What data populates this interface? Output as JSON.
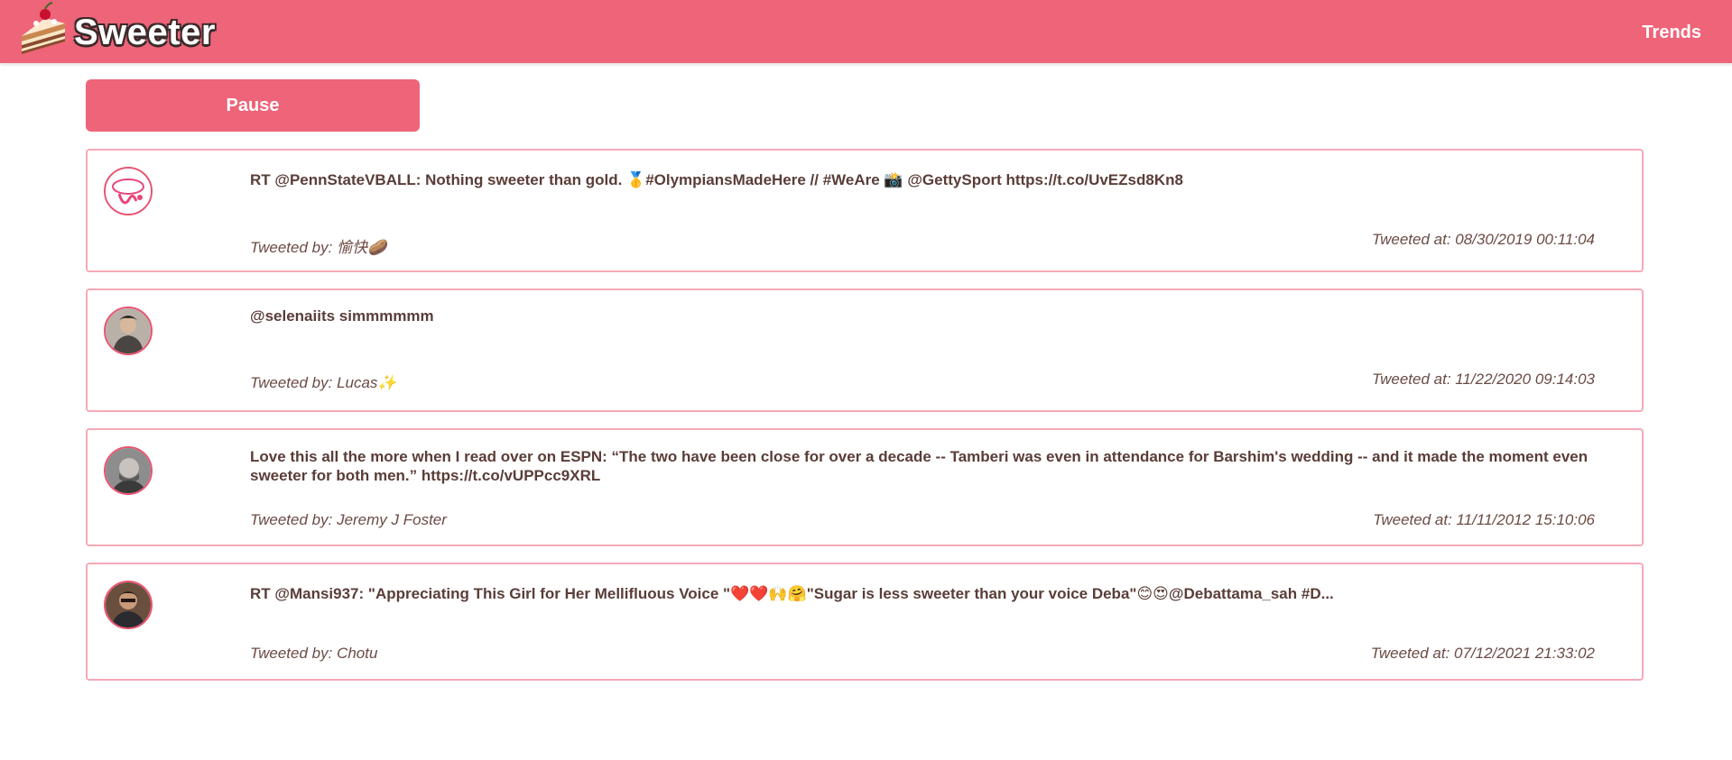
{
  "header": {
    "brand": "Sweeter",
    "nav": {
      "trends_label": "Trends"
    },
    "logo_icon": "cake-slice-icon",
    "colors": {
      "bar": "#ee6479",
      "card_border": "#f7a9b6",
      "text": "#5a3d37"
    }
  },
  "controls": {
    "pause_label": "Pause"
  },
  "tweets": [
    {
      "text": "RT @PennStateVBALL: Nothing sweeter than gold. 🥇#OlympiansMadeHere // #WeAre 📸 @GettySport https://t.co/UvEZsd8Kn8",
      "by": "Tweeted by: 愉快🥔",
      "at": "Tweeted at: 08/30/2019 00:11:04",
      "avatar": "pink-logo-avatar"
    },
    {
      "text": "@selenaiits simmmmmm",
      "by": "Tweeted by: Lucas✨",
      "at": "Tweeted at: 11/22/2020 09:14:03",
      "avatar": "person-avatar"
    },
    {
      "text": "Love this all the more when I read over on ESPN: “The two have been close for over a decade -- Tamberi was even in attendance for Barshim's wedding -- and it made the moment even sweeter for both men.” https://t.co/vUPPcc9XRL",
      "by": "Tweeted by: Jeremy J Foster",
      "at": "Tweeted at: 11/11/2012 15:10:06",
      "avatar": "person-avatar"
    },
    {
      "text": "RT @Mansi937: \"Appreciating This Girl for Her Mellifluous Voice \"❤️❤️🙌🤗\"Sugar is less sweeter than your voice Deba\"😊😍@Debattama_sah #D...",
      "by": "Tweeted by: Chotu",
      "at": "Tweeted at: 07/12/2021 21:33:02",
      "avatar": "person-avatar"
    }
  ]
}
